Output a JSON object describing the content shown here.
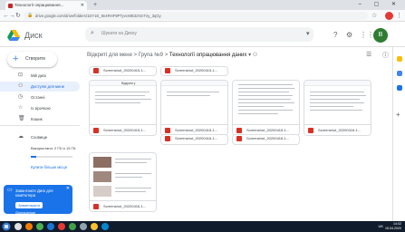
{
  "browser": {
    "tab_title": "Технології опрацювання...",
    "url": "drive.google.com/drive/folders/1DY1E_8n4RHF9PTyvcWB3zXmTny_3qGy",
    "window_controls": "– ▢ ✕"
  },
  "header": {
    "brand": "Диск",
    "search_placeholder": "Шукати на Диску",
    "avatar_letter": "В"
  },
  "sidebar": {
    "new_label": "Створити",
    "items": [
      {
        "label": "Мій диск",
        "icon": "drive-icon"
      },
      {
        "label": "Доступні для мене",
        "icon": "people-icon",
        "selected": true
      },
      {
        "label": "Останні",
        "icon": "clock-icon"
      },
      {
        "label": "Із зірочкою",
        "icon": "star-icon"
      },
      {
        "label": "Кошик",
        "icon": "trash-icon"
      }
    ],
    "storage_label": "Сховище",
    "storage_text": "Використано: 2 ГБ із 15 ГБ",
    "storage_fraction": 0.13,
    "buy_label": "Купити більше місця",
    "promo_text": "Завантажте Диск для комп'ютера",
    "promo_button": "Завантажити",
    "promo_sub": "Докладніше"
  },
  "breadcrumb": {
    "items": [
      "Відкриті для мене",
      "Група №9",
      "Технології опрацювання даних"
    ],
    "separator": ">"
  },
  "files": [
    {
      "name": "Screenshot_20200415-1..."
    },
    {
      "name": "Screenshot_20200415-1..."
    },
    {
      "name": "Screenshot_20200415-1..."
    },
    {
      "name": "Screenshot_20200415-1..."
    },
    {
      "name": "Screenshot_20200415-1..."
    },
    {
      "name": "Screenshot_20200416-1..."
    },
    {
      "name": "Screenshot_20200416-1..."
    },
    {
      "name": "Screenshot_20200416-1..."
    },
    {
      "name": "Screenshot_20200416-1..."
    }
  ],
  "doc_toolbar": {
    "page_label": "Відкрити у",
    "zoom": "1"
  },
  "taskbar": {
    "time": "14:02",
    "date": "15.04.2020",
    "lang": "UK"
  },
  "colors": {
    "accent": "#1a73e8",
    "pdf_red": "#d93025",
    "taskbar": "#101c2c"
  }
}
